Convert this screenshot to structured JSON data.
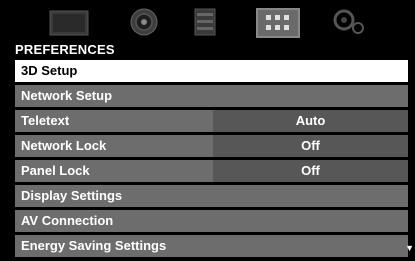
{
  "top_icons": [
    {
      "name": "picture-icon"
    },
    {
      "name": "sound-icon"
    },
    {
      "name": "applications-icon"
    },
    {
      "name": "preferences-icon",
      "active": true
    },
    {
      "name": "setup-icon"
    }
  ],
  "section": {
    "title": "PREFERENCES"
  },
  "menu": {
    "items": [
      {
        "label": "3D Setup",
        "selected": true
      },
      {
        "label": "Network Setup"
      },
      {
        "label": "Teletext",
        "value": "Auto"
      },
      {
        "label": "Network Lock",
        "value": "Off"
      },
      {
        "label": "Panel Lock",
        "value": "Off"
      },
      {
        "label": "Display Settings"
      },
      {
        "label": "AV Connection"
      },
      {
        "label": "Energy Saving Settings"
      }
    ]
  },
  "scroll_indicator": "▼",
  "colors": {
    "row_bg": "#6d6d6d",
    "value_bg": "#575757",
    "selected_bg": "#ffffff",
    "text": "#ffffff"
  }
}
